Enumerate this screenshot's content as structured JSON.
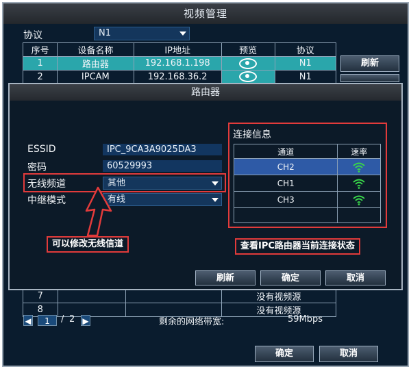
{
  "window": {
    "title": "视频管理"
  },
  "protocol": {
    "label": "协议",
    "value": "N1"
  },
  "camera_table": {
    "headers": [
      "序号",
      "设备名称",
      "IP地址",
      "预览",
      "协议"
    ],
    "rows": [
      {
        "no": "1",
        "name": "路由器",
        "ip": "192.168.1.198",
        "proto": "N1"
      },
      {
        "no": "2",
        "name": "IPCAM",
        "ip": "192.168.36.2",
        "proto": "N1"
      }
    ]
  },
  "side_buttons": {
    "refresh": "刷新"
  },
  "bottom_table": {
    "rows": [
      {
        "no": "7",
        "status": "没有视频源"
      },
      {
        "no": "8",
        "status": "没有视频源"
      }
    ]
  },
  "pagination": {
    "current": "1",
    "separator": "/",
    "total": "2"
  },
  "bandwidth": {
    "label": "剩余的网络带宽:",
    "value": "59Mbps"
  },
  "main_buttons": {
    "ok": "确定",
    "cancel": "取消"
  },
  "dialog": {
    "title": "路由器",
    "essid": {
      "label": "ESSID",
      "value": "IPC_9CA3A9025DA3"
    },
    "password": {
      "label": "密码",
      "value": "60529993"
    },
    "channel": {
      "label": "无线频道",
      "value": "其他"
    },
    "relay": {
      "label": "中继模式",
      "value": "有线"
    },
    "connection": {
      "title": "连接信息",
      "headers": [
        "通道",
        "速率"
      ],
      "rows": [
        {
          "channel": "CH2"
        },
        {
          "channel": "CH1"
        },
        {
          "channel": "CH3"
        }
      ]
    },
    "buttons": {
      "refresh": "刷新",
      "ok": "确定",
      "cancel": "取消"
    }
  },
  "annotations": {
    "left": "可以修改无线信道",
    "right": "查看IPC路由器当前连接状态"
  },
  "colors": {
    "annotation": "#e23b3b",
    "selected_row": "#2aa6ab",
    "highlight_row": "#2e5aa6",
    "wifi": "#39d64a"
  }
}
